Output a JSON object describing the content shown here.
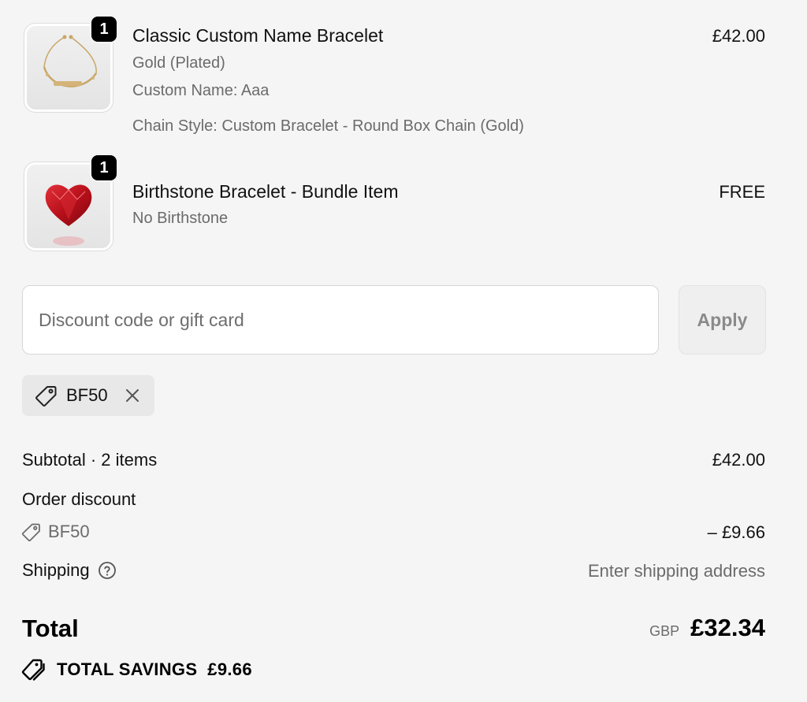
{
  "items": [
    {
      "title": "Classic Custom Name Bracelet",
      "quantity": "1",
      "price": "£42.00",
      "meta": [
        "Gold (Plated)",
        "Custom Name: Aaa",
        "Chain Style: Custom Bracelet - Round Box Chain (Gold)"
      ]
    },
    {
      "title": "Birthstone Bracelet - Bundle Item",
      "quantity": "1",
      "price": "FREE",
      "meta": [
        "No Birthstone"
      ]
    }
  ],
  "discount": {
    "placeholder": "Discount code or gift card",
    "value": "",
    "apply_label": "Apply",
    "applied_code": "BF50"
  },
  "summary": {
    "subtotal_label": "Subtotal · 2 items",
    "subtotal_value": "£42.00",
    "order_discount_label": "Order discount",
    "discount_code": "BF50",
    "discount_value": "– £9.66",
    "shipping_label": "Shipping",
    "shipping_value": "Enter shipping address",
    "total_label": "Total",
    "currency": "GBP",
    "total_value": "£32.34",
    "savings_label": "TOTAL SAVINGS",
    "savings_value": "£9.66"
  },
  "icons": {
    "tag": "tag-icon",
    "close": "close-icon",
    "help": "help-circle-icon",
    "savings_tag": "double-tag-icon"
  },
  "colors": {
    "background": "#f5f5f5",
    "text": "#111111",
    "muted": "#6b6b6b",
    "badge": "#000000",
    "gem": "#c0141e"
  }
}
